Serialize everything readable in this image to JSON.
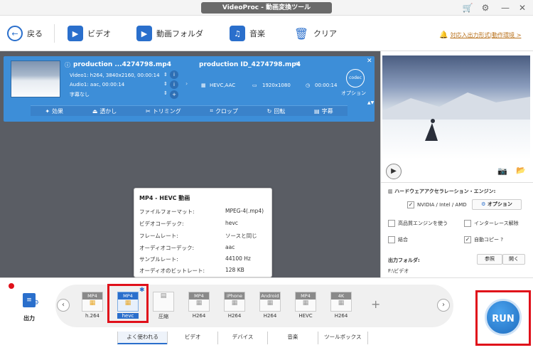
{
  "window": {
    "title": "VideoProc - 動画変換ツール"
  },
  "toolbar": {
    "back_label": "戻る",
    "video_label": "ビデオ",
    "folder_label": "動画フォルダ",
    "music_label": "音楽",
    "clear_label": "クリア",
    "notice_label": "対応入出力形式|動作環境 >"
  },
  "task": {
    "source_name": "production ...4274798.mp4",
    "video_info": "Video1: h264, 3840x2160, 00:00:14",
    "audio_info": "Audio1: aac, 00:00:14",
    "subtitle_info": "字幕なし",
    "output_name": "production ID_4274798.mp4",
    "out_codec": "HEVC,AAC",
    "out_resolution": "1920x1080",
    "out_duration": "00:00:14",
    "codec_badge": "codec",
    "option_label": "オプション",
    "edit": {
      "effects": "効果",
      "watermark": "透かし",
      "trim": "トリミング",
      "crop": "クロップ",
      "rotate": "回転",
      "subtitle": "字幕"
    }
  },
  "settings": {
    "hw_title": "ハードウェアアクセラレーション・エンジン:",
    "hw_value": "NVIDIA / Intel / AMD",
    "option_button": "オプション",
    "hq_engine": "高品質エンジンを使う",
    "deinterlace": "インターレース解除",
    "merge": "結合",
    "auto_copy": "自動コピー ?",
    "output_folder_label": "出力フォルダ:",
    "browse_button": "参照",
    "open_button": "開く",
    "output_folder_value": "F:\\ビデオ"
  },
  "tooltip": {
    "title": "MP4 - HEVC 動画",
    "rows": [
      {
        "k": "ファイルフォーマット:",
        "v": "MPEG-4(.mp4)"
      },
      {
        "k": "ビデオコーデック:",
        "v": "hevc"
      },
      {
        "k": "フレームレート:",
        "v": "ソースと同じ"
      },
      {
        "k": "オーディオコーデック:",
        "v": "aac"
      },
      {
        "k": "サンプルレート:",
        "v": "44100 Hz"
      },
      {
        "k": "オーディオのビットレート:",
        "v": "128 KB"
      }
    ]
  },
  "output": {
    "label": "出力",
    "formats": [
      {
        "head": "MP4",
        "sub": "h.264"
      },
      {
        "head": "MP4",
        "sub": "hevc"
      },
      {
        "head": "",
        "sub": "圧縮"
      },
      {
        "head": "MP4",
        "sub": "H264"
      },
      {
        "head": "iPhone",
        "sub": "H264"
      },
      {
        "head": "Android",
        "sub": "H264"
      },
      {
        "head": "MP4",
        "sub": "HEVC"
      },
      {
        "head": "4K",
        "sub": "H264"
      }
    ],
    "tabs": [
      "よく使われる",
      "ビデオ",
      "デバイス",
      "音楽",
      "ツールボックス"
    ],
    "run_label": "RUN"
  },
  "colors": {
    "accent": "#3d8ed8",
    "highlight": "#e0101a"
  }
}
